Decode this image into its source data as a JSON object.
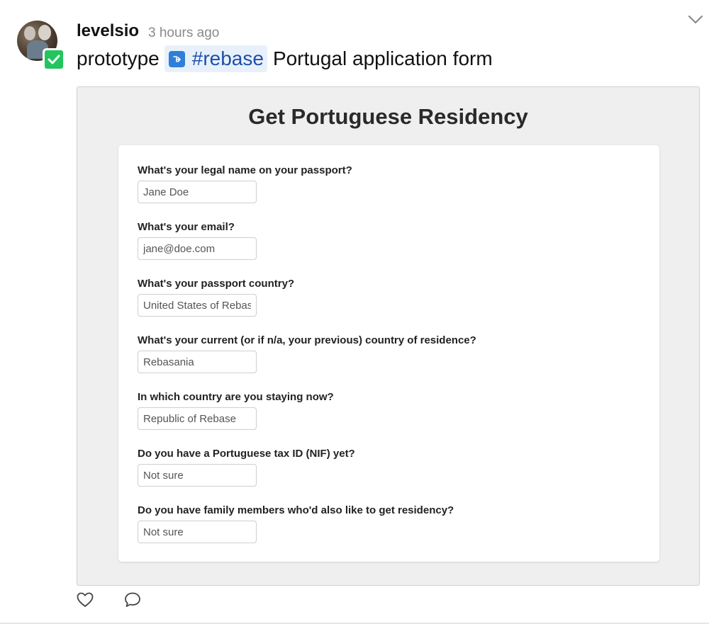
{
  "post": {
    "author": "levelsio",
    "timestamp": "3 hours ago",
    "message_prefix": "prototype",
    "tag": "#rebase",
    "message_suffix": "Portugal application form"
  },
  "form": {
    "title": "Get Portuguese Residency",
    "fields": [
      {
        "label": "What's your legal name on your passport?",
        "placeholder": "Jane Doe"
      },
      {
        "label": "What's your email?",
        "placeholder": "jane@doe.com"
      },
      {
        "label": "What's your passport country?",
        "placeholder": "United States of Rebase"
      },
      {
        "label": "What's your current (or if n/a, your previous) country of residence?",
        "placeholder": "Rebasania"
      },
      {
        "label": "In which country are you staying now?",
        "placeholder": "Republic of Rebase"
      },
      {
        "label": "Do you have a Portuguese tax ID (NIF) yet?",
        "placeholder": "Not sure"
      },
      {
        "label": "Do you have family members who'd also like to get residency?",
        "placeholder": "Not sure"
      }
    ]
  },
  "icons": {
    "status": "check-icon",
    "menu": "chevron-down-icon",
    "tag": "project-icon",
    "like": "heart-icon",
    "comment": "comment-icon"
  },
  "colors": {
    "status_badge": "#22c55e",
    "tag_background": "#e8f1fb",
    "tag_text": "#1f4fa8",
    "tag_icon": "#2f7fd8"
  }
}
